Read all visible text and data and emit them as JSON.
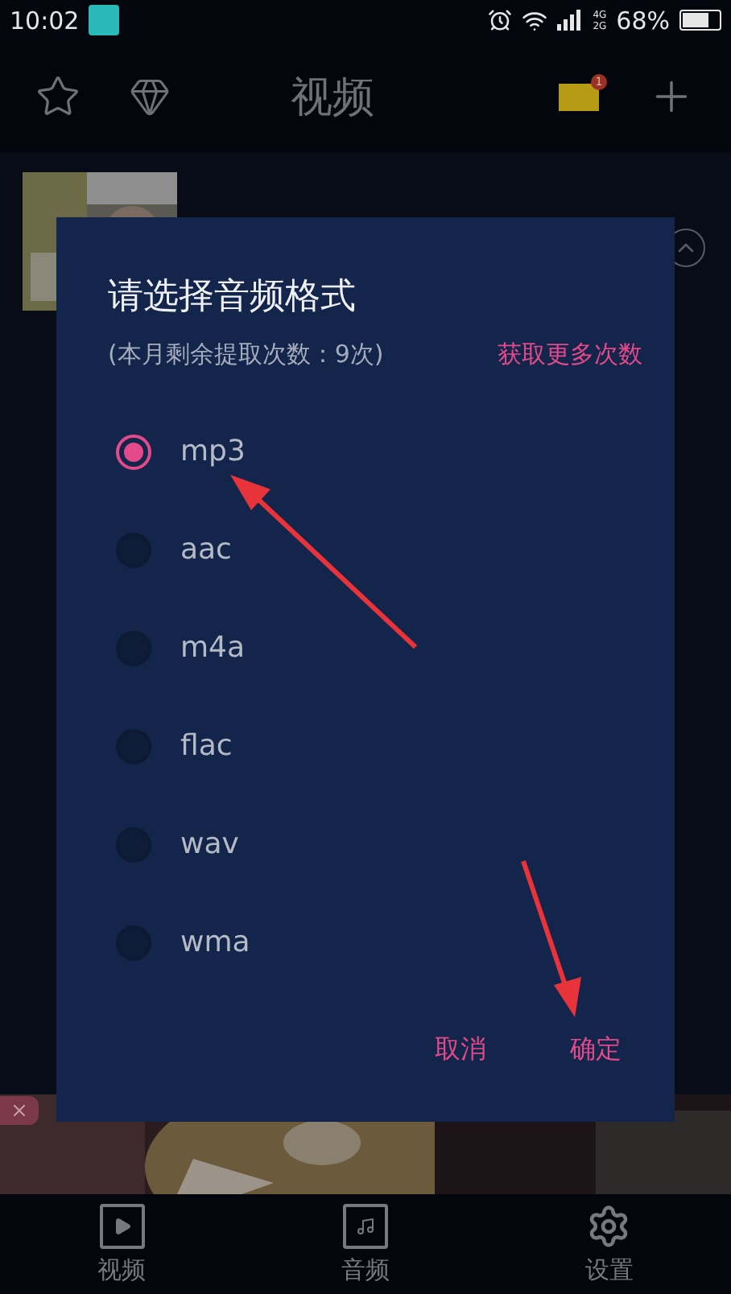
{
  "status_bar": {
    "time": "10:02",
    "network": [
      "4G",
      "2G"
    ],
    "battery": "68%"
  },
  "header": {
    "title": "视频",
    "mail_badge": "1"
  },
  "dialog": {
    "title": "请选择音频格式",
    "subtitle": "(本月剩余提取次数：9次)",
    "link": "获取更多次数",
    "options": [
      {
        "label": "mp3",
        "selected": true
      },
      {
        "label": "aac",
        "selected": false
      },
      {
        "label": "m4a",
        "selected": false
      },
      {
        "label": "flac",
        "selected": false
      },
      {
        "label": "wav",
        "selected": false
      },
      {
        "label": "wma",
        "selected": false
      }
    ],
    "buttons": [
      "取消",
      "确定"
    ]
  },
  "nav": [
    {
      "label": "视频",
      "kind": "video"
    },
    {
      "label": "音频",
      "kind": "audio"
    },
    {
      "label": "设置",
      "kind": "settings"
    }
  ]
}
